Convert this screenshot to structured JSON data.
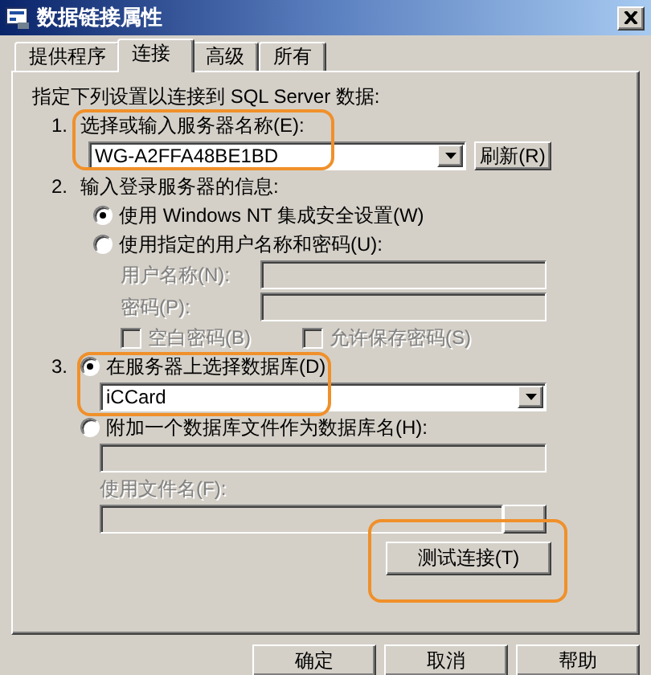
{
  "window": {
    "title": "数据链接属性"
  },
  "tabs": [
    {
      "label": "提供程序",
      "selected": false
    },
    {
      "label": "连接",
      "selected": true
    },
    {
      "label": "高级",
      "selected": false
    },
    {
      "label": "所有",
      "selected": false
    }
  ],
  "heading": "指定下列设置以连接到 SQL Server 数据:",
  "server": {
    "number": "1.",
    "label": "选择或输入服务器名称(E):",
    "value": "WG-A2FFA48BE1BD",
    "refresh_button": "刷新(R)"
  },
  "login": {
    "number": "2.",
    "label": "输入登录服务器的信息:",
    "options": [
      {
        "label": "使用 Windows NT 集成安全设置(W)",
        "selected": true
      },
      {
        "label": "使用指定的用户名称和密码(U):",
        "selected": false
      }
    ],
    "username": {
      "label": "用户名称(N):",
      "disabled": true
    },
    "password": {
      "label": "密码(P):",
      "disabled": true
    },
    "checkboxes": [
      {
        "label": "空白密码(B)",
        "checked": false,
        "disabled": true
      },
      {
        "label": "允许保存密码(S)",
        "checked": false,
        "disabled": true
      }
    ]
  },
  "database": {
    "number": "3.",
    "options": [
      {
        "label": "在服务器上选择数据库(D)",
        "selected": true,
        "value": "iCCard"
      },
      {
        "label": "附加一个数据库文件作为数据库名(H):",
        "selected": false
      }
    ],
    "file_label": "使用文件名(F):",
    "test_button": "测试连接(T)"
  },
  "buttons": [
    "确定",
    "取消",
    "帮助"
  ]
}
